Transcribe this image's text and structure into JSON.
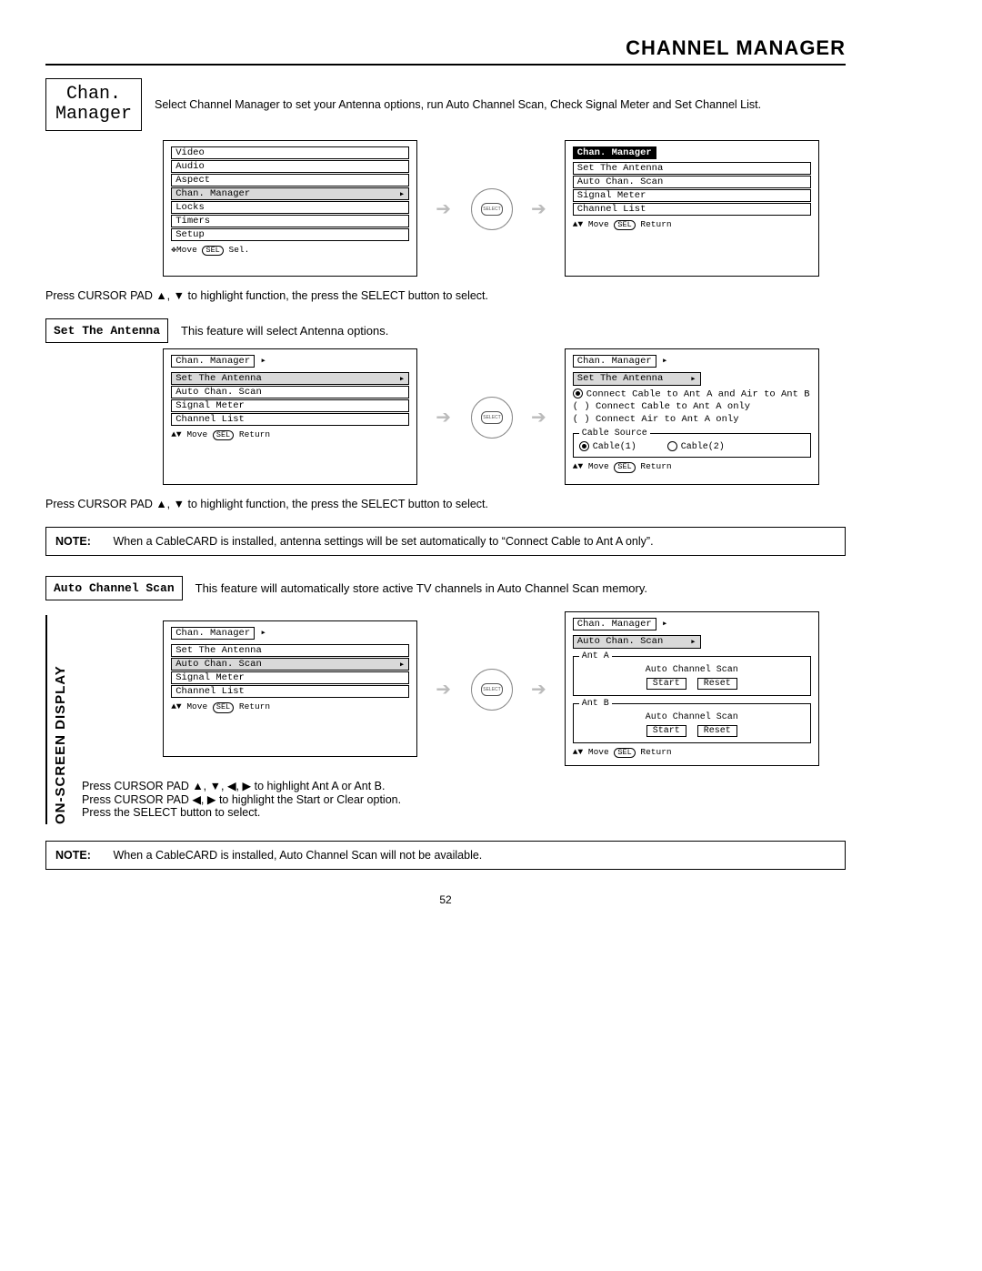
{
  "header": {
    "title": "CHANNEL MANAGER"
  },
  "chan_manager_box": {
    "line1": "Chan.",
    "line2": "Manager"
  },
  "intro": "Select Channel Manager to set your Antenna options, run Auto Channel Scan, Check Signal Meter and Set Channel List.",
  "screens1": {
    "left": {
      "items": [
        "Video",
        "Audio",
        "Aspect",
        "Chan. Manager",
        "Locks",
        "Timers",
        "Setup"
      ],
      "highlight_index": 3,
      "hint_move": "Move",
      "hint_sel_pill": "SEL",
      "hint_sel": "Sel."
    },
    "right": {
      "title": "Chan. Manager",
      "items": [
        "Set The Antenna",
        "Auto Chan. Scan",
        "Signal Meter",
        "Channel List"
      ],
      "hint_move": "Move",
      "hint_sel_pill": "SEL",
      "hint_return": "Return"
    }
  },
  "instr1": "Press CURSOR PAD ▲, ▼ to highlight function, the press the SELECT button to select.",
  "set_antenna": {
    "label": "Set The Antenna",
    "desc": "This feature will select Antenna options."
  },
  "screens2": {
    "left": {
      "title_outline": "Chan. Manager",
      "items": [
        "Set The Antenna",
        "Auto Chan. Scan",
        "Signal Meter",
        "Channel List"
      ],
      "highlight_index": 0,
      "hint_move": "Move",
      "hint_sel_pill": "SEL",
      "hint_return": "Return"
    },
    "right": {
      "title_outline": "Chan. Manager",
      "highlight_item": "Set The Antenna",
      "options": [
        {
          "filled": true,
          "text": "Connect Cable to Ant A and Air to Ant B"
        },
        {
          "filled": false,
          "text": "Connect Cable to Ant A only"
        },
        {
          "filled": false,
          "text": "Connect Air to Ant A only"
        }
      ],
      "cable_legend": "Cable Source",
      "cable1": "Cable(1)",
      "cable2": "Cable(2)",
      "hint_move": "Move",
      "hint_sel_pill": "SEL",
      "hint_return": "Return"
    }
  },
  "instr2": "Press CURSOR PAD ▲, ▼ to highlight function, the press the SELECT button to select.",
  "note1": {
    "label": "NOTE:",
    "text": "When a CableCARD is installed, antenna settings will be set automatically to “Connect Cable to Ant A only”."
  },
  "auto_scan": {
    "label": "Auto Channel Scan",
    "desc": "This feature will automatically store active TV channels in Auto Channel Scan memory."
  },
  "screens3": {
    "left": {
      "title_outline": "Chan. Manager",
      "items": [
        "Set The Antenna",
        "Auto Chan. Scan",
        "Signal Meter",
        "Channel List"
      ],
      "highlight_index": 1,
      "hint_move": "Move",
      "hint_sel_pill": "SEL",
      "hint_return": "Return"
    },
    "right": {
      "title_outline": "Chan. Manager",
      "highlight_item": "Auto Chan. Scan",
      "ant_a_legend": "Ant A",
      "ant_b_legend": "Ant B",
      "scan_title": "Auto Channel Scan",
      "start": "Start",
      "reset": "Reset",
      "hint_move": "Move",
      "hint_sel_pill": "SEL",
      "hint_return": "Return"
    }
  },
  "instr3a": "Press CURSOR PAD ▲, ▼, ◀, ▶ to highlight Ant A or Ant B.",
  "instr3b": "Press CURSOR PAD ◀, ▶ to highlight the Start or Clear option.",
  "instr3c": "Press the SELECT button to select.",
  "note2": {
    "label": "NOTE:",
    "text": "When a CableCARD is installed, Auto Channel Scan will not be available."
  },
  "side_label": "ON-SCREEN DISPLAY",
  "select_label": "SELECT",
  "page_number": "52"
}
